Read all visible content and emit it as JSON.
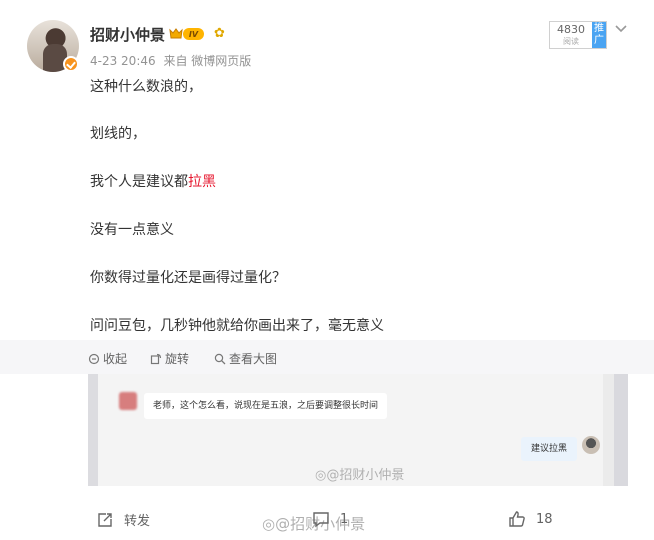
{
  "user": {
    "name": "招财小仲景",
    "vip_badge": "IV"
  },
  "meta": {
    "time": "4-23 20:46",
    "source": "来自 微博网页版"
  },
  "reads": {
    "count": "4830",
    "label": "阅读",
    "promo_label": "推广"
  },
  "post": {
    "lines": [
      "这种什么数浪的，",
      "划线的，",
      "我个人是建议都",
      "没有一点意义",
      "你数得过量化还是画得过量化？",
      "问问豆包，几秒钟他就给你画出来了，毫无意义"
    ],
    "highlight": "拉黑"
  },
  "image_toolbar": {
    "collapse": "收起",
    "rotate": "旋转",
    "view_large": "查看大图"
  },
  "preview": {
    "left_message": "老师，这个怎么看，说现在是五浪，之后要调整很长时间",
    "right_message": "建议拉黑",
    "watermark": "@招财小仲景"
  },
  "actions": {
    "repost": "转发",
    "comments": "1",
    "likes": "18"
  },
  "page_watermark": "@招财小仲景",
  "colors": {
    "highlight": "#e6162d",
    "promo": "#4aa4f2",
    "badge": "#f7931e"
  }
}
